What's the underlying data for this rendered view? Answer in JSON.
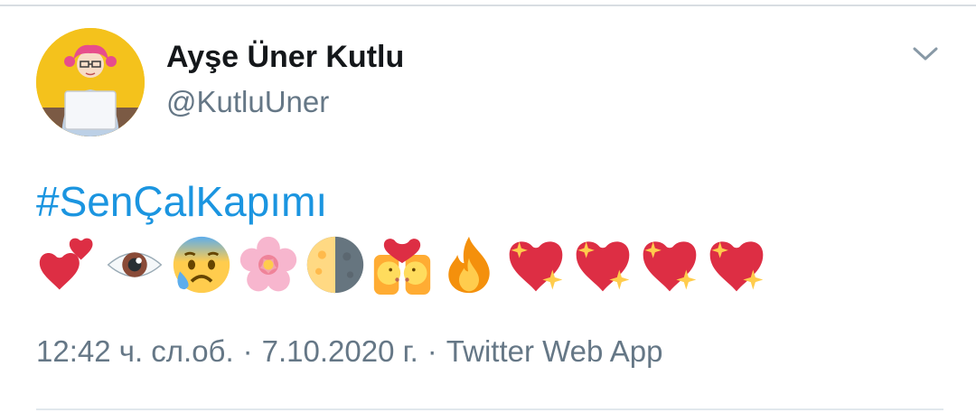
{
  "tweet": {
    "author": {
      "display_name": "Ayşe Üner Kutlu",
      "handle": "@KutluUner",
      "avatar_icon": "avatar-illustration"
    },
    "menu_icon": "chevron-down-icon",
    "hashtag": "#SenÇalKapımı",
    "emojis": [
      "two-hearts",
      "eye",
      "anxious-face-with-sweat",
      "cherry-blossom",
      "last-quarter-moon",
      "kiss",
      "fire",
      "sparkling-heart",
      "sparkling-heart",
      "sparkling-heart",
      "sparkling-heart"
    ],
    "meta": {
      "time": "12:42 ч. сл.об.",
      "separator": "·",
      "date": "7.10.2020 г.",
      "source": "Twitter Web App"
    }
  },
  "colors": {
    "hashtag": "#1b95e0",
    "secondary_text": "#657786",
    "primary_text": "#14171a"
  }
}
